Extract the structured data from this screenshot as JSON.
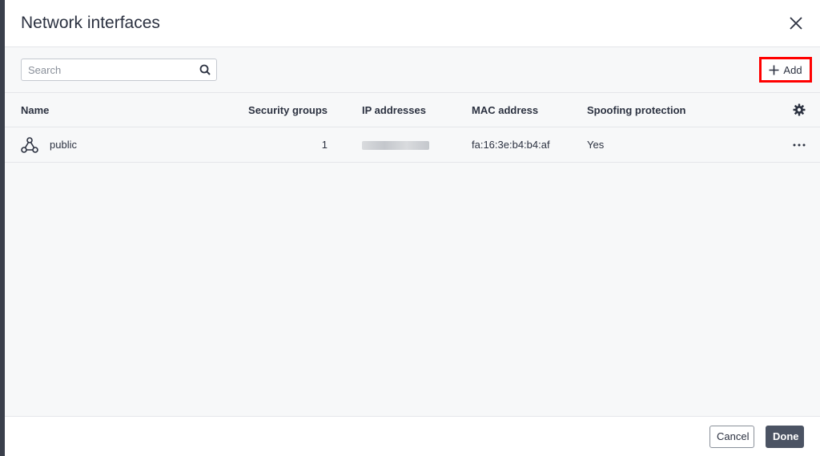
{
  "dialog": {
    "title": "Network interfaces",
    "close_icon": "close-icon"
  },
  "toolbar": {
    "search_placeholder": "Search",
    "search_value": "",
    "add_label": "Add",
    "add_highlight_color": "#ff0000"
  },
  "table": {
    "columns": [
      "Name",
      "Security groups",
      "IP addresses",
      "MAC address",
      "Spoofing protection"
    ],
    "rows": [
      {
        "name": "public",
        "icon": "network-icon",
        "security_groups": "1",
        "ip_addresses": "",
        "mac_address": "fa:16:3e:b4:b4:af",
        "spoofing_protection": "Yes"
      }
    ]
  },
  "footer": {
    "cancel_label": "Cancel",
    "done_label": "Done"
  }
}
